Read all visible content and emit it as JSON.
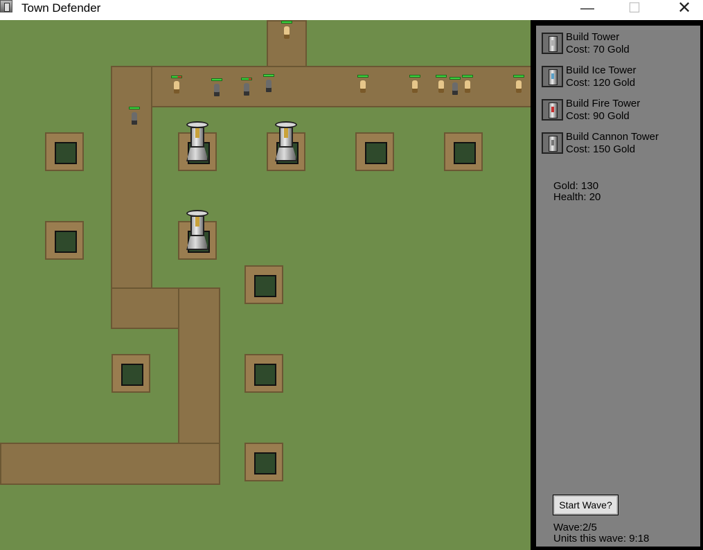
{
  "window": {
    "title": "Town Defender",
    "icon": "tower-app-icon",
    "controls": {
      "minimize": "—",
      "maximize": "☐",
      "close": "✕"
    }
  },
  "shop": {
    "items": [
      {
        "name": "Build Tower",
        "cost": "Cost: 70 Gold",
        "icon": "tower-icon",
        "accent": "#b0b0b0"
      },
      {
        "name": "Build Ice Tower",
        "cost": "Cost: 120 Gold",
        "icon": "ice-tower-icon",
        "accent": "#5aa0c8"
      },
      {
        "name": "Build Fire Tower",
        "cost": "Cost: 90 Gold",
        "icon": "fire-tower-icon",
        "accent": "#c83030"
      },
      {
        "name": "Build Cannon Tower",
        "cost": "Cost: 150 Gold",
        "icon": "cannon-tower-icon",
        "accent": "#777777"
      }
    ]
  },
  "stats": {
    "gold": "Gold: 130",
    "health": "Health: 20"
  },
  "wave": {
    "start_label": "Start Wave?",
    "progress": "Wave:2/5",
    "units": "Units this wave: 9:18"
  },
  "colors": {
    "grass": "#6e8d4a",
    "path": "#8b7248",
    "pad_center": "#2f4a2c",
    "panel": "#808080"
  }
}
